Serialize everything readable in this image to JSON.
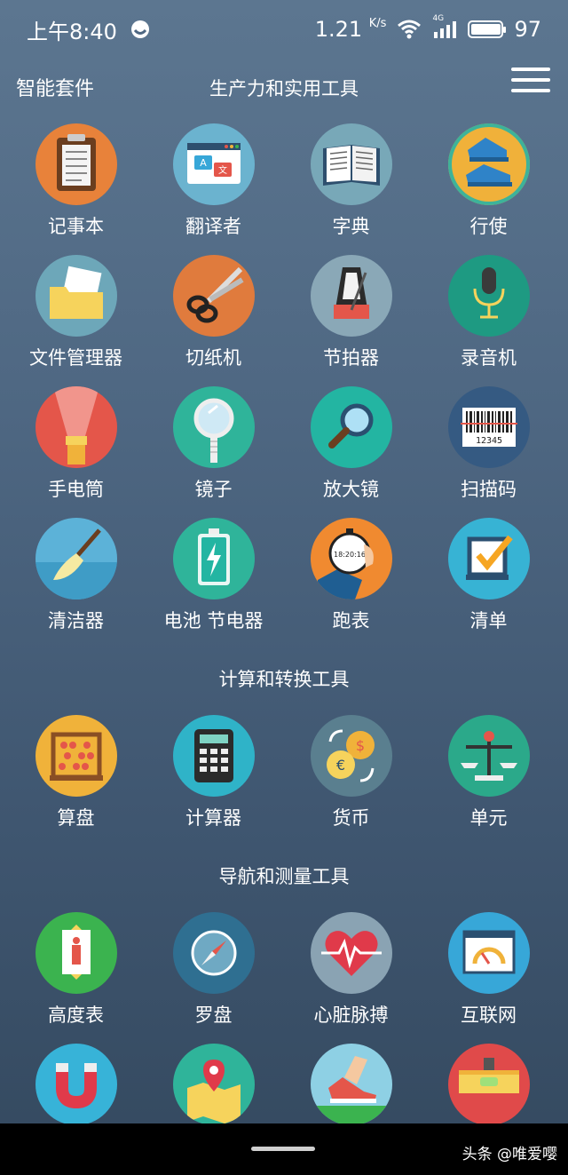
{
  "status_bar": {
    "time": "上午8:40",
    "net_speed": "1.21",
    "net_unit": "K/s",
    "signal_label": "4G",
    "battery": "97"
  },
  "header": {
    "app_name": "智能套件",
    "title": "生产力和实用工具"
  },
  "sections": {
    "productivity": {
      "items": [
        {
          "label": "记事本",
          "icon": "notepad-icon",
          "color": "#e8823a"
        },
        {
          "label": "翻译者",
          "icon": "translator-icon",
          "color": "#6bb3cf"
        },
        {
          "label": "字典",
          "icon": "dictionary-icon",
          "color": "#78a8b8"
        },
        {
          "label": "行使",
          "icon": "sneaker-icon",
          "color": "#f0b13a"
        },
        {
          "label": "文件管理器",
          "icon": "folder-icon",
          "color": "#6da7b9"
        },
        {
          "label": "切纸机",
          "icon": "scissors-icon",
          "color": "#e07b3d"
        },
        {
          "label": "节拍器",
          "icon": "metronome-icon",
          "color": "#8aa8b7"
        },
        {
          "label": "录音机",
          "icon": "microphone-icon",
          "color": "#1e9a82"
        },
        {
          "label": "手电筒",
          "icon": "flashlight-icon",
          "color": "#e4564a"
        },
        {
          "label": "镜子",
          "icon": "mirror-icon",
          "color": "#2fb49a"
        },
        {
          "label": "放大镜",
          "icon": "magnifier-icon",
          "color": "#23b5a2"
        },
        {
          "label": "扫描码",
          "icon": "barcode-icon",
          "color": "#355a82"
        },
        {
          "label": "清洁器",
          "icon": "broom-icon",
          "color": "#5cb2d8"
        },
        {
          "label": "电池 节电器",
          "icon": "battery-icon",
          "color": "#2fb49a"
        },
        {
          "label": "跑表",
          "icon": "stopwatch-icon",
          "color": "#f08a30"
        },
        {
          "label": "清单",
          "icon": "checklist-icon",
          "color": "#37b3d4"
        }
      ]
    },
    "calc": {
      "title": "计算和转换工具",
      "items": [
        {
          "label": "算盘",
          "icon": "abacus-icon",
          "color": "#f0b23a"
        },
        {
          "label": "计算器",
          "icon": "calculator-icon",
          "color": "#2fb3c8"
        },
        {
          "label": "货币",
          "icon": "currency-icon",
          "color": "#5a7f8f"
        },
        {
          "label": "单元",
          "icon": "scale-icon",
          "color": "#2ba98a"
        }
      ]
    },
    "nav": {
      "title": "导航和测量工具",
      "items": [
        {
          "label": "高度表",
          "icon": "elevator-icon",
          "color": "#3bb34f"
        },
        {
          "label": "罗盘",
          "icon": "compass-icon",
          "color": "#2f6f91"
        },
        {
          "label": "心脏脉搏",
          "icon": "heart-pulse-icon",
          "color": "#8aa3b3"
        },
        {
          "label": "互联网",
          "icon": "speedometer-icon",
          "color": "#37a7d8"
        },
        {
          "label": "",
          "icon": "magnet-icon",
          "color": "#37b3d8"
        },
        {
          "label": "",
          "icon": "map-pin-icon",
          "color": "#2fb49a"
        },
        {
          "label": "",
          "icon": "running-shoe-icon",
          "color": "#8ed0e4"
        },
        {
          "label": "",
          "icon": "spirit-level-icon",
          "color": "#e04a4a"
        }
      ]
    }
  },
  "card_values": {
    "stopwatch_time": "18:20:16",
    "barcode_digits": "12345",
    "translate_a": "A",
    "translate_b": "文",
    "currency_a": "$",
    "currency_b": "€"
  },
  "footer": {
    "watermark": "头条 @唯爱嘤"
  }
}
